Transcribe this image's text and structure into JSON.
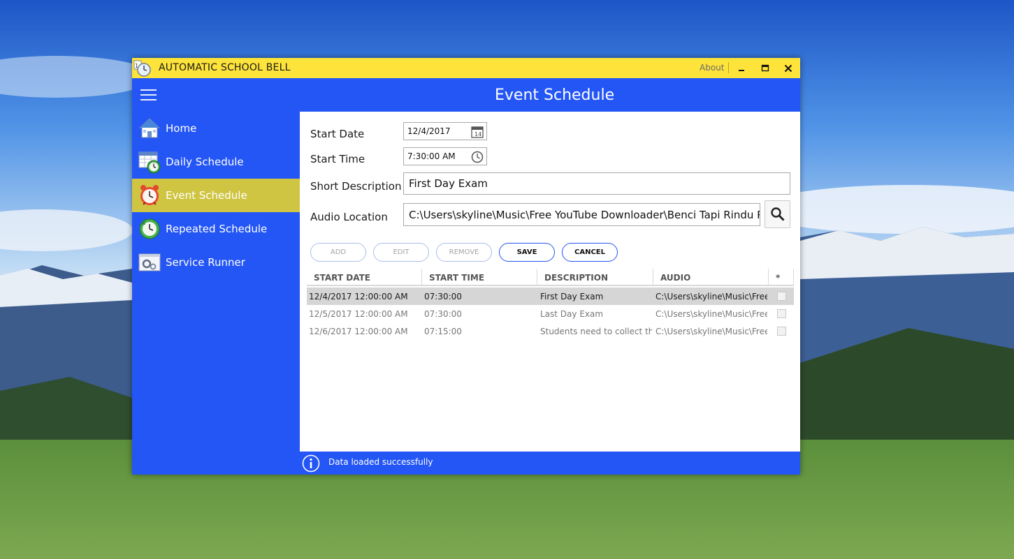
{
  "window": {
    "title": "AUTOMATIC SCHOOL BELL",
    "about_label": "About",
    "minimize_glyph": "▁",
    "maximize_glyph": "▣",
    "close_glyph": "✕"
  },
  "header": {
    "title": "Event Schedule"
  },
  "sidebar": {
    "items": [
      {
        "label": "Home",
        "icon": "house-icon",
        "active": false
      },
      {
        "label": "Daily Schedule",
        "icon": "calendar-clock-icon",
        "active": false
      },
      {
        "label": "Event Schedule",
        "icon": "alarm-clock-icon",
        "active": true
      },
      {
        "label": "Repeated Schedule",
        "icon": "repeat-clock-icon",
        "active": false
      },
      {
        "label": "Service Runner",
        "icon": "service-gear-icon",
        "active": false
      }
    ]
  },
  "form": {
    "start_date_label": "Start Date",
    "start_date_value": "12/4/2017",
    "start_time_label": "Start Time",
    "start_time_value": "7:30:00 AM",
    "short_description_label": "Short Description",
    "short_description_value": "First Day Exam",
    "audio_location_label": "Audio Location",
    "audio_location_value": "C:\\Users\\skyline\\Music\\Free YouTube Downloader\\Benci Tapi Rindu Rin"
  },
  "actions": {
    "add": "ADD",
    "edit": "EDIT",
    "remove": "REMOVE",
    "save": "SAVE",
    "cancel": "CANCEL"
  },
  "grid": {
    "columns": [
      "START DATE",
      "START TIME",
      "DESCRIPTION",
      "AUDIO",
      "*"
    ],
    "rows": [
      {
        "start_date": "12/4/2017 12:00:00 AM",
        "start_time": "07:30:00",
        "description": "First Day Exam",
        "audio": "C:\\Users\\skyline\\Music\\Free Yo",
        "selected": true
      },
      {
        "start_date": "12/5/2017 12:00:00 AM",
        "start_time": "07:30:00",
        "description": "Last Day Exam",
        "audio": "C:\\Users\\skyline\\Music\\Free Yo",
        "selected": false
      },
      {
        "start_date": "12/6/2017 12:00:00 AM",
        "start_time": "07:15:00",
        "description": "Students need to collect their",
        "audio": "C:\\Users\\skyline\\Music\\Free Yo",
        "selected": false
      }
    ]
  },
  "status": {
    "text": "Data loaded successfully",
    "icon": "info-icon"
  },
  "colors": {
    "titlebar": "#fde33a",
    "primary": "#2456f6",
    "active_nav": "#cfc543"
  }
}
